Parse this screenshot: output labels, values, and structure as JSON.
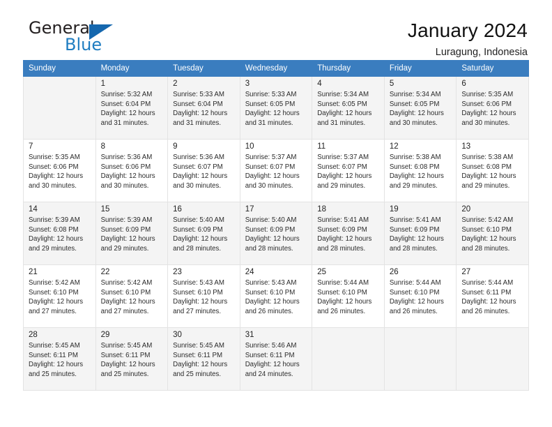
{
  "brand": {
    "name_part1": "General",
    "name_part2": "Blue",
    "logo_icon": "triangle-flag-icon",
    "accent_color": "#1567ae"
  },
  "header": {
    "title": "January 2024",
    "subtitle": "Luragung, Indonesia"
  },
  "calendar": {
    "header_bg": "#3a7dbf",
    "weekdays": [
      "Sunday",
      "Monday",
      "Tuesday",
      "Wednesday",
      "Thursday",
      "Friday",
      "Saturday"
    ],
    "weeks": [
      {
        "shaded": true,
        "days": [
          {
            "num": "",
            "detail": "",
            "empty": true
          },
          {
            "num": "1",
            "detail": "Sunrise: 5:32 AM\nSunset: 6:04 PM\nDaylight: 12 hours\nand 31 minutes."
          },
          {
            "num": "2",
            "detail": "Sunrise: 5:33 AM\nSunset: 6:04 PM\nDaylight: 12 hours\nand 31 minutes."
          },
          {
            "num": "3",
            "detail": "Sunrise: 5:33 AM\nSunset: 6:05 PM\nDaylight: 12 hours\nand 31 minutes."
          },
          {
            "num": "4",
            "detail": "Sunrise: 5:34 AM\nSunset: 6:05 PM\nDaylight: 12 hours\nand 31 minutes."
          },
          {
            "num": "5",
            "detail": "Sunrise: 5:34 AM\nSunset: 6:05 PM\nDaylight: 12 hours\nand 30 minutes."
          },
          {
            "num": "6",
            "detail": "Sunrise: 5:35 AM\nSunset: 6:06 PM\nDaylight: 12 hours\nand 30 minutes."
          }
        ]
      },
      {
        "shaded": false,
        "days": [
          {
            "num": "7",
            "detail": "Sunrise: 5:35 AM\nSunset: 6:06 PM\nDaylight: 12 hours\nand 30 minutes."
          },
          {
            "num": "8",
            "detail": "Sunrise: 5:36 AM\nSunset: 6:06 PM\nDaylight: 12 hours\nand 30 minutes."
          },
          {
            "num": "9",
            "detail": "Sunrise: 5:36 AM\nSunset: 6:07 PM\nDaylight: 12 hours\nand 30 minutes."
          },
          {
            "num": "10",
            "detail": "Sunrise: 5:37 AM\nSunset: 6:07 PM\nDaylight: 12 hours\nand 30 minutes."
          },
          {
            "num": "11",
            "detail": "Sunrise: 5:37 AM\nSunset: 6:07 PM\nDaylight: 12 hours\nand 29 minutes."
          },
          {
            "num": "12",
            "detail": "Sunrise: 5:38 AM\nSunset: 6:08 PM\nDaylight: 12 hours\nand 29 minutes."
          },
          {
            "num": "13",
            "detail": "Sunrise: 5:38 AM\nSunset: 6:08 PM\nDaylight: 12 hours\nand 29 minutes."
          }
        ]
      },
      {
        "shaded": true,
        "days": [
          {
            "num": "14",
            "detail": "Sunrise: 5:39 AM\nSunset: 6:08 PM\nDaylight: 12 hours\nand 29 minutes."
          },
          {
            "num": "15",
            "detail": "Sunrise: 5:39 AM\nSunset: 6:09 PM\nDaylight: 12 hours\nand 29 minutes."
          },
          {
            "num": "16",
            "detail": "Sunrise: 5:40 AM\nSunset: 6:09 PM\nDaylight: 12 hours\nand 28 minutes."
          },
          {
            "num": "17",
            "detail": "Sunrise: 5:40 AM\nSunset: 6:09 PM\nDaylight: 12 hours\nand 28 minutes."
          },
          {
            "num": "18",
            "detail": "Sunrise: 5:41 AM\nSunset: 6:09 PM\nDaylight: 12 hours\nand 28 minutes."
          },
          {
            "num": "19",
            "detail": "Sunrise: 5:41 AM\nSunset: 6:09 PM\nDaylight: 12 hours\nand 28 minutes."
          },
          {
            "num": "20",
            "detail": "Sunrise: 5:42 AM\nSunset: 6:10 PM\nDaylight: 12 hours\nand 28 minutes."
          }
        ]
      },
      {
        "shaded": false,
        "days": [
          {
            "num": "21",
            "detail": "Sunrise: 5:42 AM\nSunset: 6:10 PM\nDaylight: 12 hours\nand 27 minutes."
          },
          {
            "num": "22",
            "detail": "Sunrise: 5:42 AM\nSunset: 6:10 PM\nDaylight: 12 hours\nand 27 minutes."
          },
          {
            "num": "23",
            "detail": "Sunrise: 5:43 AM\nSunset: 6:10 PM\nDaylight: 12 hours\nand 27 minutes."
          },
          {
            "num": "24",
            "detail": "Sunrise: 5:43 AM\nSunset: 6:10 PM\nDaylight: 12 hours\nand 26 minutes."
          },
          {
            "num": "25",
            "detail": "Sunrise: 5:44 AM\nSunset: 6:10 PM\nDaylight: 12 hours\nand 26 minutes."
          },
          {
            "num": "26",
            "detail": "Sunrise: 5:44 AM\nSunset: 6:10 PM\nDaylight: 12 hours\nand 26 minutes."
          },
          {
            "num": "27",
            "detail": "Sunrise: 5:44 AM\nSunset: 6:11 PM\nDaylight: 12 hours\nand 26 minutes."
          }
        ]
      },
      {
        "shaded": true,
        "days": [
          {
            "num": "28",
            "detail": "Sunrise: 5:45 AM\nSunset: 6:11 PM\nDaylight: 12 hours\nand 25 minutes."
          },
          {
            "num": "29",
            "detail": "Sunrise: 5:45 AM\nSunset: 6:11 PM\nDaylight: 12 hours\nand 25 minutes."
          },
          {
            "num": "30",
            "detail": "Sunrise: 5:45 AM\nSunset: 6:11 PM\nDaylight: 12 hours\nand 25 minutes."
          },
          {
            "num": "31",
            "detail": "Sunrise: 5:46 AM\nSunset: 6:11 PM\nDaylight: 12 hours\nand 24 minutes."
          },
          {
            "num": "",
            "detail": "",
            "empty": true
          },
          {
            "num": "",
            "detail": "",
            "empty": true
          },
          {
            "num": "",
            "detail": "",
            "empty": true
          }
        ]
      }
    ]
  }
}
